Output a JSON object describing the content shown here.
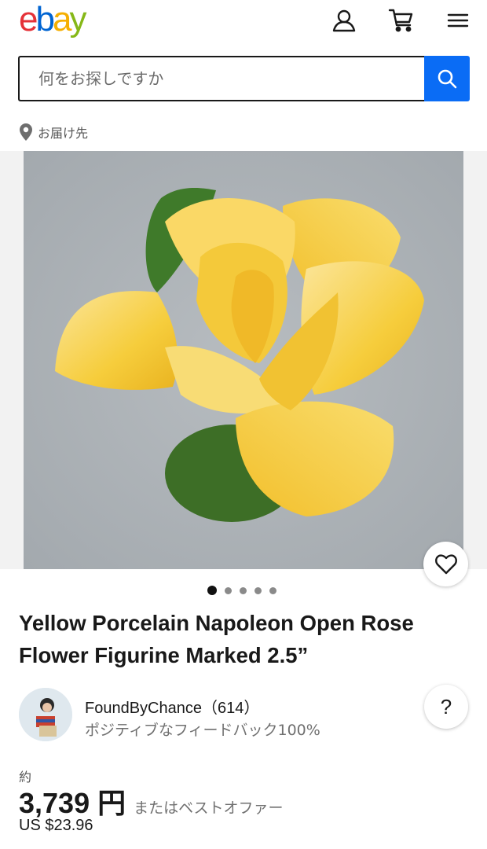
{
  "header": {
    "logo": {
      "e": "e",
      "b": "b",
      "a": "a",
      "y": "y"
    },
    "icons": [
      "user-icon",
      "cart-icon",
      "menu-icon"
    ]
  },
  "search": {
    "placeholder": "何をお探しですか",
    "value": ""
  },
  "delivery": {
    "label": "お届け先"
  },
  "gallery": {
    "image_count": 5,
    "active_index": 0
  },
  "listing": {
    "title": "Yellow Porcelain Napoleon Open Rose Flower Figurine Marked 2.5”"
  },
  "seller": {
    "name": "FoundByChance（614）",
    "feedback": "ポジティブなフィードバック100%"
  },
  "price": {
    "approx_label": "約",
    "amount": "3,739 円",
    "offer": "またはベストオファー",
    "usd": "US $23.96"
  },
  "colors": {
    "ebay_red": "#e53238",
    "ebay_blue": "#0064d2",
    "ebay_yellow": "#f5af02",
    "ebay_green": "#86b817",
    "search_button": "#0a6cf5"
  }
}
